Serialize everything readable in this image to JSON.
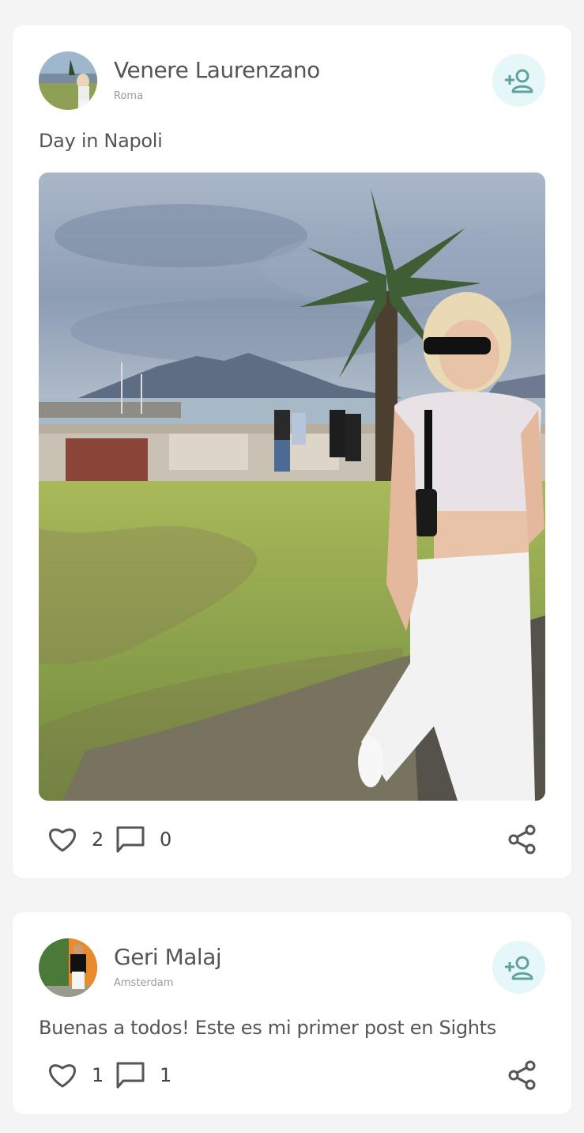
{
  "posts": [
    {
      "user": {
        "name": "Venere Laurenzano",
        "location": "Roma",
        "avatar_icon": "avatar-photo"
      },
      "caption": "Day in Napoli",
      "has_image": true,
      "likes": "2",
      "comments": "0"
    },
    {
      "user": {
        "name": "Geri Malaj",
        "location": "Amsterdam",
        "avatar_icon": "avatar-photo"
      },
      "caption": "Buenas a todos! Este es mi primer post en Sights",
      "has_image": false,
      "likes": "1",
      "comments": "1"
    }
  ],
  "icons": {
    "follow": "add-user-icon",
    "like": "heart-icon",
    "comment": "comment-icon",
    "share": "share-icon"
  },
  "colors": {
    "follow_bg": "#e6f7f9",
    "follow_icon": "#5fa39c",
    "icon": "#555555"
  }
}
